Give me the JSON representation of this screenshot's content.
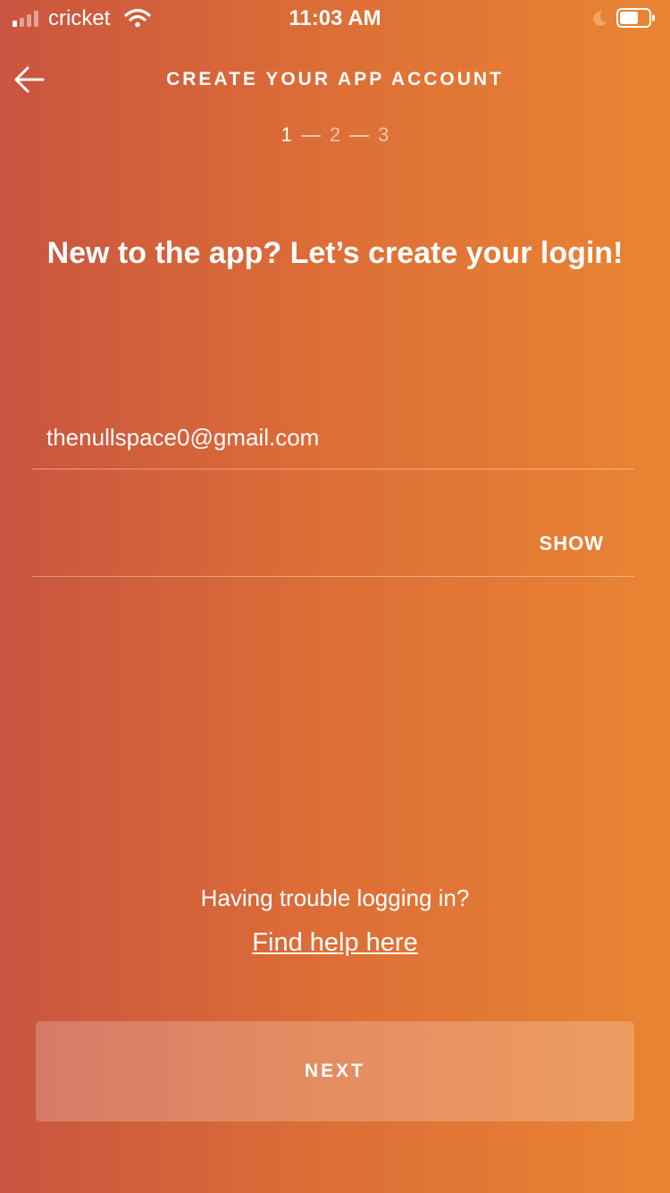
{
  "status_bar": {
    "carrier": "cricket",
    "time": "11:03 AM",
    "signal_bars_active": 1,
    "signal_bars_total": 4,
    "icons": [
      "signal-icon",
      "wifi-icon",
      "moon-icon",
      "battery-icon"
    ]
  },
  "header": {
    "back_icon": "arrow-left-icon",
    "title": "CREATE YOUR APP ACCOUNT",
    "steps": [
      "1",
      "2",
      "3"
    ],
    "current_step": 1
  },
  "headline": "New to the app? Let’s create your login!",
  "form": {
    "email_value": "thenullspace0@gmail.com",
    "password_value": "",
    "show_label": "SHOW"
  },
  "help": {
    "trouble_text": "Having trouble logging in?",
    "link_text": "Find help here"
  },
  "next_label": "NEXT",
  "colors": {
    "gradient_start": "#c95440",
    "gradient_end": "#e98533",
    "text": "#ffffff"
  }
}
